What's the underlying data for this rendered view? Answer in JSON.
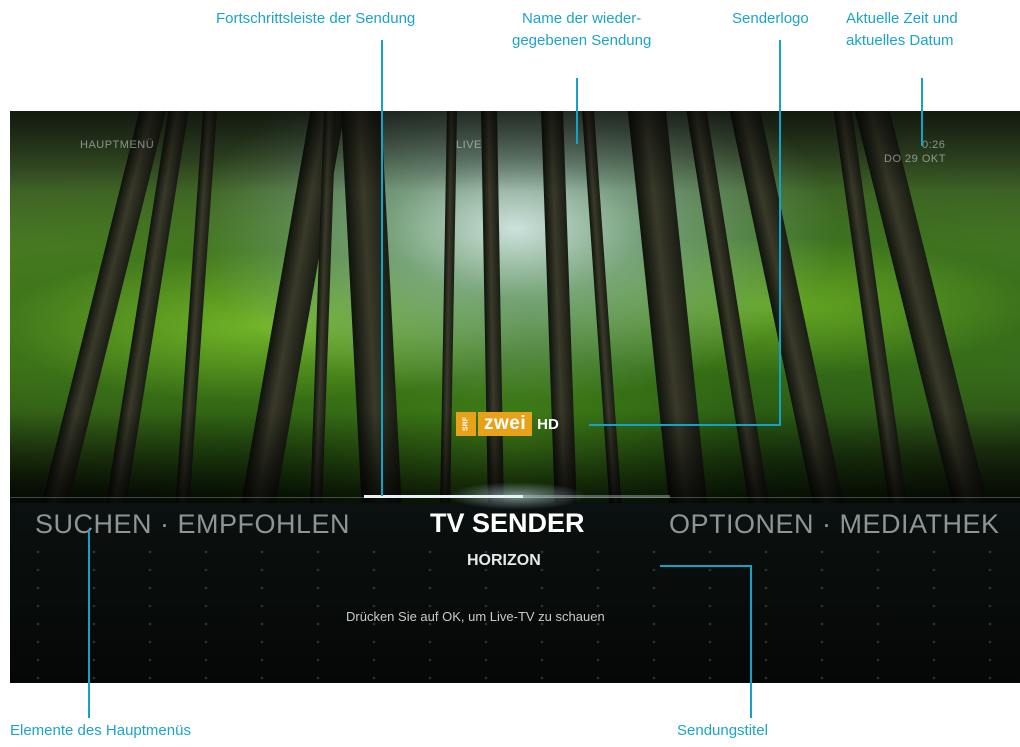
{
  "callouts": {
    "progress_bar": "Fortschrittsleiste der Sendung",
    "show_name_line1": "Name der wieder-",
    "show_name_line2": "gegebenen Sendung",
    "channel_logo": "Senderlogo",
    "time_date_line1": "Aktuelle Zeit und",
    "time_date_line2": "aktuelles Datum",
    "main_menu_items": "Elemente des Hauptmenüs",
    "show_title": "Sendungstitel"
  },
  "tv": {
    "top_left_label": "HAUPTMENÜ",
    "live_label": "LIVE",
    "time": "0:26",
    "date": "DO 29 OKT",
    "channel_logo": {
      "srf": "SRF",
      "name": "zwei",
      "suffix": "HD"
    },
    "menu_left": "SUCHEN · EMPFOHLEN",
    "menu_selected": "TV SENDER",
    "menu_right": "OPTIONEN · MEDIATHEK",
    "program_title": "HORIZON",
    "hint": "Drücken Sie auf OK, um Live-TV zu schauen",
    "progress_percent": 52
  },
  "colors": {
    "callout": "#1aa5c8",
    "logo_orange": "#e8a21a",
    "menu_inactive": "#8d9597",
    "menu_active": "#ffffff"
  }
}
